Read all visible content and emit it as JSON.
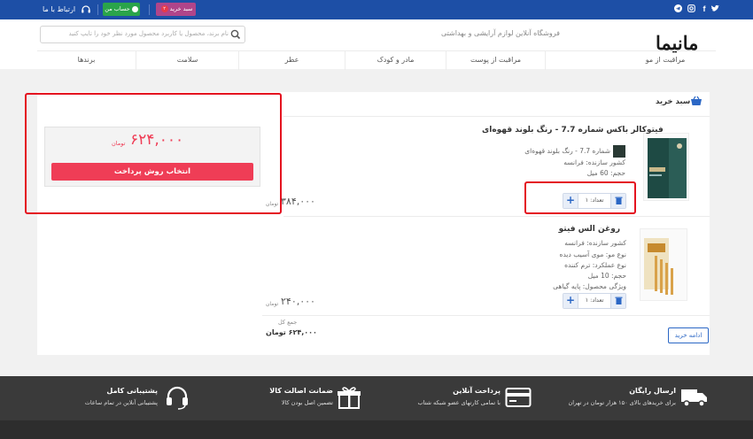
{
  "topbar": {
    "contact_label": "ارتباط با ما",
    "account_label": "حساب من",
    "cart_label": "سبد خرید",
    "cart_count": "۲",
    "social_icons": [
      "twitter-icon",
      "facebook-icon",
      "instagram-icon",
      "telegram-icon"
    ]
  },
  "header": {
    "search_placeholder": "نام برند، محصول یا کاربرد محصول مورد نظر خود را تایپ کنید",
    "tagline": "فروشگاه آنلاین لوازم آرایشی و بهداشتی",
    "logo": "مانیما"
  },
  "nav": {
    "items": [
      "مراقبت از مو",
      "مراقبت از پوست",
      "مادر و کودک",
      "عطر",
      "سلامت",
      "برندها"
    ]
  },
  "cart": {
    "title": "سبد خرید",
    "items": [
      {
        "name": "فیتوکالر باکس شماره 7.7 - رنگ بلوند قهوه‌ای",
        "variant": "شماره 7.7 - رنگ بلوند قهوه‌ای",
        "lines": [
          "کشور سازنده: فرانسه",
          "حجم: 60 میل"
        ],
        "qty_label": "تعداد: ۱",
        "price": "۳۸۴,۰۰۰",
        "currency": "تومان"
      },
      {
        "name": "روغن الس فیتو",
        "lines": [
          "کشور سازنده: فرانسه",
          "نوع مو: موی آسیب دیده",
          "نوع عملکرد: ترم کننده",
          "حجم: 10 میل",
          "ویژگی محصول: پایه گیاهی"
        ],
        "qty_label": "تعداد: ۱",
        "price": "۲۴۰,۰۰۰",
        "currency": "تومان"
      }
    ],
    "subtotal_label": "جمع کل",
    "subtotal_value": "۶۲۴,۰۰۰ تومان",
    "continue_label": "ادامه خرید"
  },
  "summary": {
    "total": "۶۲۴,۰۰۰",
    "currency": "تومان",
    "pay_button": "انتخاب روش پرداخت"
  },
  "footer": {
    "features": [
      {
        "title": "ارسال رایگان",
        "subtitle": "برای خریدهای بالای ۱۵۰ هزار تومان در تهران",
        "icon": "truck-icon"
      },
      {
        "title": "پرداخت آنلاین",
        "subtitle": "با تمامی کارتهای عضو شبکه شتاب",
        "icon": "credit-card-icon"
      },
      {
        "title": "ضمانت اصالت کالا",
        "subtitle": "تضمین اصل بودن کالا",
        "icon": "gift-icon"
      },
      {
        "title": "پشتیبانی کامل",
        "subtitle": "پشتیبانی آنلاین در تمام ساعات",
        "icon": "headset-icon"
      }
    ]
  },
  "colors": {
    "topbar": "#1d4fa6",
    "pay_button": "#ef3d56",
    "account_button": "#2aa44a",
    "cart_button": "#b0458a",
    "annotation_box": "#e4101f"
  }
}
